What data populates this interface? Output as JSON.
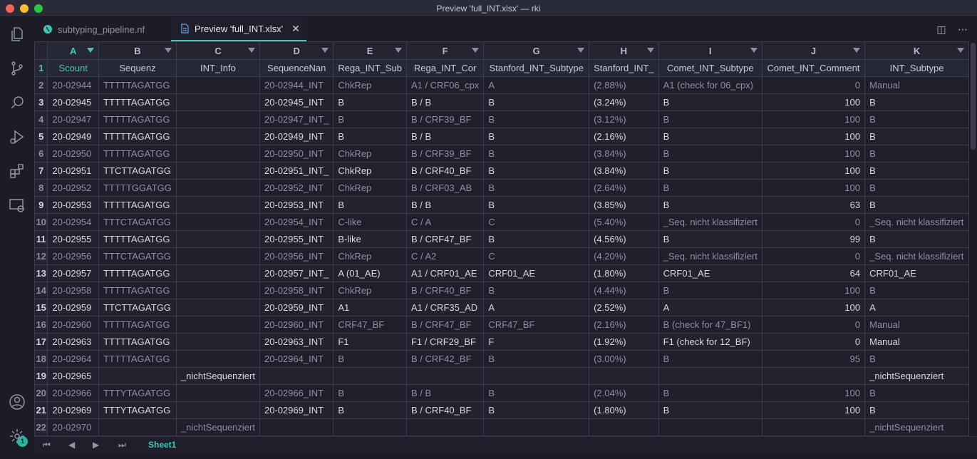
{
  "window": {
    "title": "Preview 'full_INT.xlsx' — rki"
  },
  "tabs": [
    {
      "label": "subtyping_pipeline.nf"
    },
    {
      "label": "Preview 'full_INT.xlsx'"
    }
  ],
  "sheet": {
    "tab_label": "Sheet1",
    "columns": [
      "A",
      "B",
      "C",
      "D",
      "E",
      "F",
      "G",
      "H",
      "I",
      "J",
      "K"
    ],
    "headers": [
      "Scount",
      "Sequenz",
      "INT_Info",
      "SequenceNan",
      "Rega_INT_Sub",
      "Rega_INT_Cor",
      "Stanford_INT_Subtype",
      "Stanford_INT_",
      "Comet_INT_Subtype",
      "Comet_INT_Comment",
      "INT_Subtype"
    ],
    "rows": [
      {
        "n": "2",
        "c": [
          "20-02944",
          "TTTTTAGATGG",
          "",
          "20-02944_INT",
          "ChkRep",
          "A1 / CRF06_cpx",
          "A",
          "(2.88%)",
          "A1 (check for 06_cpx)",
          "0",
          "Manual"
        ]
      },
      {
        "n": "3",
        "c": [
          "20-02945",
          "TTTTTAGATGG",
          "",
          "20-02945_INT",
          "B",
          "B / B",
          "B",
          "(3.24%)",
          "B",
          "100",
          "B"
        ]
      },
      {
        "n": "4",
        "c": [
          "20-02947",
          "TTTTTAGATGG",
          "",
          "20-02947_INT_",
          "B",
          "B / CRF39_BF",
          "B",
          "(3.12%)",
          "B",
          "100",
          "B"
        ]
      },
      {
        "n": "5",
        "c": [
          "20-02949",
          "TTTTTAGATGG",
          "",
          "20-02949_INT",
          "B",
          "B / B",
          "B",
          "(2.16%)",
          "B",
          "100",
          "B"
        ]
      },
      {
        "n": "6",
        "c": [
          "20-02950",
          "TTTTTAGATGG",
          "",
          "20-02950_INT",
          "ChkRep",
          "B / CRF39_BF",
          "B",
          "(3.84%)",
          "B",
          "100",
          "B"
        ]
      },
      {
        "n": "7",
        "c": [
          "20-02951",
          "TTCTTAGATGG",
          "",
          "20-02951_INT_",
          "ChkRep",
          "B / CRF40_BF",
          "B",
          "(3.84%)",
          "B",
          "100",
          "B"
        ]
      },
      {
        "n": "8",
        "c": [
          "20-02952",
          "TTTTTGGATGG",
          "",
          "20-02952_INT",
          "ChkRep",
          "B / CRF03_AB",
          "B",
          "(2.64%)",
          "B",
          "100",
          "B"
        ]
      },
      {
        "n": "9",
        "c": [
          "20-02953",
          "TTTTTAGATGG",
          "",
          "20-02953_INT",
          "B",
          "B / B",
          "B",
          "(3.85%)",
          "B",
          "63",
          "B"
        ]
      },
      {
        "n": "10",
        "c": [
          "20-02954",
          "TTTCTAGATGG",
          "",
          "20-02954_INT",
          "C-like",
          "C / A",
          "C",
          "(5.40%)",
          "_Seq. nicht klassifiziert",
          "0",
          "_Seq. nicht klassifiziert"
        ]
      },
      {
        "n": "11",
        "c": [
          "20-02955",
          "TTTTTAGATGG",
          "",
          "20-02955_INT",
          "B-like",
          "B / CRF47_BF",
          "B",
          "(4.56%)",
          "B",
          "99",
          "B"
        ]
      },
      {
        "n": "12",
        "c": [
          "20-02956",
          "TTTCTAGATGG",
          "",
          "20-02956_INT",
          "ChkRep",
          "C / A2",
          "C",
          "(4.20%)",
          "_Seq. nicht klassifiziert",
          "0",
          "_Seq. nicht klassifiziert"
        ]
      },
      {
        "n": "13",
        "c": [
          "20-02957",
          "TTTTTAGATGG",
          "",
          "20-02957_INT_",
          "A (01_AE)",
          "A1 / CRF01_AE",
          "CRF01_AE",
          "(1.80%)",
          "CRF01_AE",
          "64",
          "CRF01_AE"
        ]
      },
      {
        "n": "14",
        "c": [
          "20-02958",
          "TTTTTAGATGG",
          "",
          "20-02958_INT",
          "ChkRep",
          "B / CRF40_BF",
          "B",
          "(4.44%)",
          "B",
          "100",
          "B"
        ]
      },
      {
        "n": "15",
        "c": [
          "20-02959",
          "TTCTTAGATGG",
          "",
          "20-02959_INT",
          "A1",
          "A1 / CRF35_AD",
          "A",
          "(2.52%)",
          "A",
          "100",
          "A"
        ]
      },
      {
        "n": "16",
        "c": [
          "20-02960",
          "TTTTTAGATGG",
          "",
          "20-02960_INT",
          "CRF47_BF",
          "B / CRF47_BF",
          "CRF47_BF",
          "(2.16%)",
          "B (check for 47_BF1)",
          "0",
          "Manual"
        ]
      },
      {
        "n": "17",
        "c": [
          "20-02963",
          "TTTTTAGATGG",
          "",
          "20-02963_INT",
          "F1",
          "F1 / CRF29_BF",
          "F",
          "(1.92%)",
          "F1 (check for 12_BF)",
          "0",
          "Manual"
        ]
      },
      {
        "n": "18",
        "c": [
          "20-02964",
          "TTTTTAGATGG",
          "",
          "20-02964_INT",
          "B",
          "B / CRF42_BF",
          "B",
          "(3.00%)",
          "B",
          "95",
          "B"
        ]
      },
      {
        "n": "19",
        "c": [
          "20-02965",
          "",
          "_nichtSequenziert",
          "",
          "",
          "",
          "",
          "",
          "",
          "",
          "_nichtSequenziert"
        ]
      },
      {
        "n": "20",
        "c": [
          "20-02966",
          "TTTYTAGATGG",
          "",
          "20-02966_INT",
          "B",
          "B / B",
          "B",
          "(2.04%)",
          "B",
          "100",
          "B"
        ]
      },
      {
        "n": "21",
        "c": [
          "20-02969",
          "TTTYTAGATGG",
          "",
          "20-02969_INT",
          "B",
          "B / CRF40_BF",
          "B",
          "(1.80%)",
          "B",
          "100",
          "B"
        ]
      },
      {
        "n": "22",
        "c": [
          "20-02970",
          "",
          "_nichtSequenziert",
          "",
          "",
          "",
          "",
          "",
          "",
          "",
          "_nichtSequenziert"
        ]
      }
    ]
  },
  "icons": {
    "activity": [
      "files-icon",
      "source-control-icon",
      "search-icon",
      "run-debug-icon",
      "extensions-icon",
      "remote-explorer-icon",
      "account-icon",
      "settings-gear-icon"
    ],
    "settings_badge": "1"
  },
  "colors": {
    "accent": "#3ec9b6"
  }
}
